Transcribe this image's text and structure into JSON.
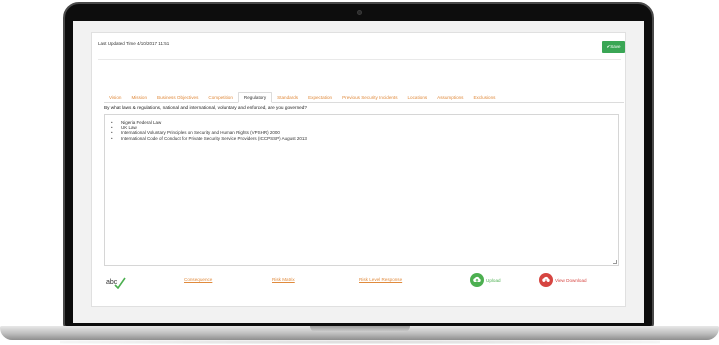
{
  "header": {
    "last_updated": "Last Updated Time 4/10/2017 11:51",
    "save_label": "✔Save"
  },
  "tabs": [
    {
      "label": "Vision"
    },
    {
      "label": "Mission"
    },
    {
      "label": "Business Objectives"
    },
    {
      "label": "Competition"
    },
    {
      "label": "Regulatory",
      "active": true
    },
    {
      "label": "Standards"
    },
    {
      "label": "Expectation"
    },
    {
      "label": "Previous Security Incidents"
    },
    {
      "label": "Locations"
    },
    {
      "label": "Assumptions"
    },
    {
      "label": "Exclusions"
    }
  ],
  "question": "By what laws & regulations, national and international, voluntary and enforced, are you governed?",
  "answer_items": [
    "Nigeria Federal Law",
    "UK Law",
    "International Voluntary Principles on Security and Human Rights (VPSHR) 2000",
    "International Code of Conduct for Private Security Service Providers (ICCPSSP) August 2013"
  ],
  "footer": {
    "consequence_label": "Consequence",
    "risk_matrix_label": "Risk Matrix",
    "risk_level_response_label": "Risk Level Response",
    "upload_label": "Upload",
    "view_download_label": "View Download"
  },
  "colors": {
    "accent": "#e08a3c",
    "save_green": "#3aa655",
    "upload_green": "#4caf50",
    "download_red": "#d64541"
  },
  "icons": {
    "spell_check": "spell-check-icon",
    "upload": "cloud-upload-icon",
    "download": "cloud-download-icon"
  }
}
